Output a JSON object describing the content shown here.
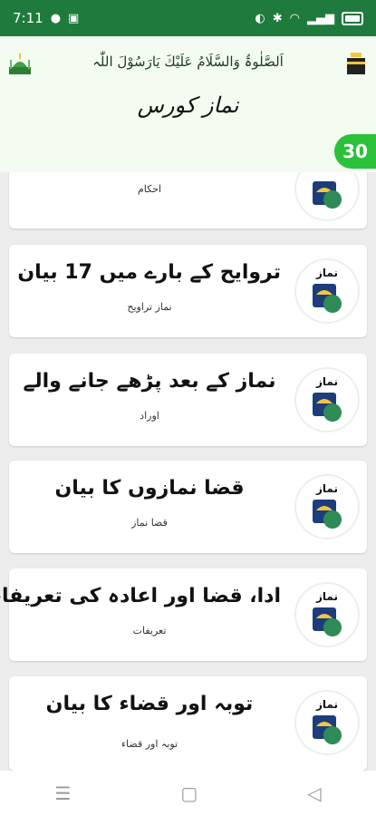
{
  "status_bar": {
    "time": "7:11"
  },
  "header": {
    "banner_text": "اَلصَّلٰوۃُ وَالسَّلَامُ عَلَیْكَ یَارَسُوْلَ اللّٰہ",
    "title": "نماز کورس"
  },
  "counter": "30",
  "items": [
    {
      "title": "",
      "subtitle": "احکام"
    },
    {
      "title": "تروایح کے بارے میں 17 بیان",
      "subtitle": "نماز تراویح"
    },
    {
      "title": "نماز کے بعد پڑھے جانے والے",
      "subtitle": "اوراد"
    },
    {
      "title": "قضا نمازوں کا بیان",
      "subtitle": "قضا نماز"
    },
    {
      "title": "ادا، قضا اور اعادہ کی تعریفات",
      "subtitle": "تعریفات"
    },
    {
      "title": "توبہ اور قضاء کا بیان",
      "subtitle": "توبہ اور قضاء"
    }
  ],
  "thumb_label": "نماز",
  "nav": {
    "recent_icon": "recent-apps-icon",
    "home_icon": "home-icon",
    "back_icon": "back-icon"
  },
  "colors": {
    "accent": "#1f7a3d",
    "badge": "#2cc13b",
    "header_bg": "#f4fbf0"
  }
}
